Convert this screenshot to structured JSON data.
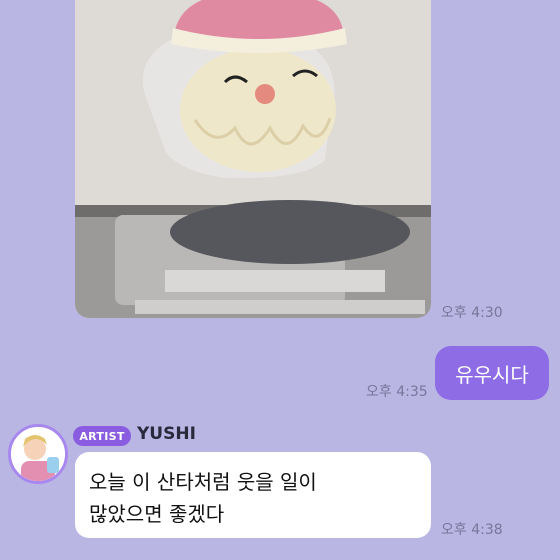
{
  "messages": [
    {
      "type": "image",
      "time": "오후 4:30"
    },
    {
      "type": "mine",
      "text": "유우시다",
      "time": "오후 4:35"
    },
    {
      "type": "artist",
      "badge": "ARTIST",
      "sender": "YUSHI",
      "lines": [
        "오늘 이 산타처럼 웃을 일이",
        "많았으면 좋겠다"
      ],
      "time": "오후 4:38"
    }
  ],
  "colors": {
    "background": "#b9b6e3",
    "my_bubble": "#8e6ce6",
    "artist_badge": "#8a5ce0",
    "timestamp": "#77769a"
  }
}
